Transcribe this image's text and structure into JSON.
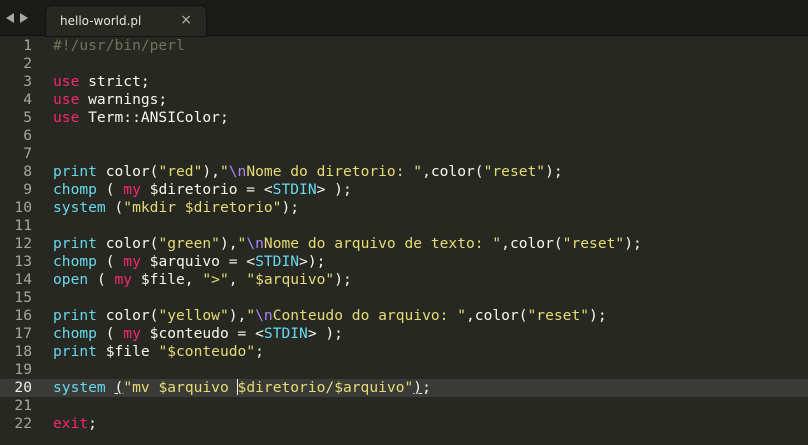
{
  "tab": {
    "title": "hello-world.pl",
    "close_glyph": "×",
    "back_icon": "chevron-left-icon",
    "forward_icon": "chevron-right-icon"
  },
  "colors": {
    "background": "#272822",
    "keyword": "#f92672",
    "function": "#66d9ef",
    "string": "#e6db74",
    "escape": "#ae81ff",
    "comment": "#75715e"
  },
  "editor": {
    "line_numbers": [
      "1",
      "2",
      "3",
      "4",
      "5",
      "6",
      "7",
      "8",
      "9",
      "10",
      "11",
      "12",
      "13",
      "14",
      "15",
      "16",
      "17",
      "18",
      "19",
      "20",
      "21",
      "22"
    ],
    "lines": {
      "l1": {
        "a": "#!/usr/bin/perl"
      },
      "l3": {
        "a": "use",
        "b": " strict;"
      },
      "l4": {
        "a": "use",
        "b": " warnings;"
      },
      "l5": {
        "a": "use",
        "b": " Term::ANSIColor;"
      },
      "l8": {
        "a": "print",
        "b": " color(",
        "c": "\"red\"",
        "d": "),",
        "e": "\"",
        "f": "\\n",
        "g": "Nome do diretorio: \"",
        "h": ",color(",
        "i": "\"reset\"",
        "j": ");"
      },
      "l9": {
        "a": "chomp",
        "b": " ( ",
        "c": "my",
        "d": " $diretorio = <",
        "e": "STDIN",
        "f": "> );"
      },
      "l10": {
        "a": "system",
        "b": " (",
        "c": "\"mkdir $diretorio\"",
        "d": ");"
      },
      "l12": {
        "a": "print",
        "b": " color(",
        "c": "\"green\"",
        "d": "),",
        "e": "\"",
        "f": "\\n",
        "g": "Nome do arquivo de texto: \"",
        "h": ",color(",
        "i": "\"reset\"",
        "j": ");"
      },
      "l13": {
        "a": "chomp",
        "b": " ( ",
        "c": "my",
        "d": " $arquivo = <",
        "e": "STDIN",
        "f": ">);"
      },
      "l14": {
        "a": "open",
        "b": " ( ",
        "c": "my",
        "d": " $file, ",
        "e": "\">\"",
        "f": ", ",
        "g": "\"$arquivo\"",
        "h": ");"
      },
      "l16": {
        "a": "print",
        "b": " color(",
        "c": "\"yellow\"",
        "d": "),",
        "e": "\"",
        "f": "\\n",
        "g": "Conteudo do arquivo: \"",
        "h": ",color(",
        "i": "\"reset\"",
        "j": ");"
      },
      "l17": {
        "a": "chomp",
        "b": " ( ",
        "c": "my",
        "d": " $conteudo = <",
        "e": "STDIN",
        "f": "> );"
      },
      "l18": {
        "a": "print",
        "b": " $file ",
        "c": "\"$conteudo\"",
        "d": ";"
      },
      "l20": {
        "a": "system",
        "b": " ",
        "c": "(",
        "d": "\"mv $arquivo ",
        "e": "$diretorio/$arquivo\"",
        "f": ")",
        "g": ";"
      },
      "l22": {
        "a": "exit",
        "b": ";"
      }
    }
  }
}
